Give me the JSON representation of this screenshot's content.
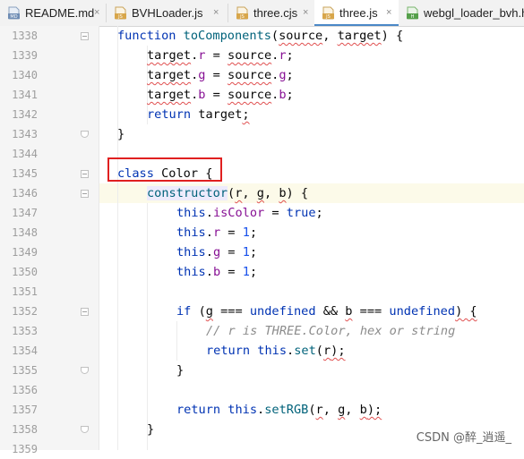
{
  "tabs": [
    {
      "label": "README.md",
      "icon": "markdown-file-icon",
      "icon_text": "MD",
      "icon_color": "#6e8cb4",
      "active": false
    },
    {
      "label": "BVHLoader.js",
      "icon": "js-file-icon",
      "icon_text": "JS",
      "icon_color": "#d8a64a",
      "active": false
    },
    {
      "label": "three.cjs",
      "icon": "js-file-icon",
      "icon_text": "JS",
      "icon_color": "#d8a64a",
      "active": false
    },
    {
      "label": "three.js",
      "icon": "js-file-icon",
      "icon_text": "JS",
      "icon_color": "#d8a64a",
      "active": true
    },
    {
      "label": "webgl_loader_bvh.ht",
      "icon": "html-file-icon",
      "icon_text": "H",
      "icon_color": "#55a04a",
      "active": false
    }
  ],
  "close_glyph": "×",
  "lines": [
    {
      "n": "1338"
    },
    {
      "n": "1339"
    },
    {
      "n": "1340"
    },
    {
      "n": "1341"
    },
    {
      "n": "1342"
    },
    {
      "n": "1343"
    },
    {
      "n": "1344"
    },
    {
      "n": "1345"
    },
    {
      "n": "1346"
    },
    {
      "n": "1347"
    },
    {
      "n": "1348"
    },
    {
      "n": "1349"
    },
    {
      "n": "1350"
    },
    {
      "n": "1351"
    },
    {
      "n": "1352"
    },
    {
      "n": "1353"
    },
    {
      "n": "1354"
    },
    {
      "n": "1355"
    },
    {
      "n": "1356"
    },
    {
      "n": "1357"
    },
    {
      "n": "1358"
    },
    {
      "n": "1359"
    }
  ],
  "code": {
    "l1338": {
      "kw": "function ",
      "fn": "toComponents",
      "p1": "(",
      "a1": "source",
      "p2": ", ",
      "a2": "target",
      "p3": ") {"
    },
    "l1339": {
      "v": "target",
      "p": ".",
      "prop": "r",
      "eq": " = ",
      "v2": "source",
      "p2": ".",
      "prop2": "r",
      "end": ";"
    },
    "l1340": {
      "v": "target",
      "p": ".",
      "prop": "g",
      "eq": " = ",
      "v2": "source",
      "p2": ".",
      "prop2": "g",
      "end": ";"
    },
    "l1341": {
      "v": "target",
      "p": ".",
      "prop": "b",
      "eq": " = ",
      "v2": "source",
      "p2": ".",
      "prop2": "b",
      "end": ";"
    },
    "l1342": {
      "kw": "return ",
      "v": "target",
      "end": ";"
    },
    "l1343": {
      "t": "}"
    },
    "l1345": {
      "kw": "class ",
      "name": "Color",
      "end": " {"
    },
    "l1346": {
      "fn": "constructor",
      "p1": "(",
      "a1": "r",
      "p2": ", ",
      "a2": "g",
      "p3": ", ",
      "a3": "b",
      "p4": ") {"
    },
    "l1347": {
      "kw": "this",
      "p": ".",
      "prop": "isColor",
      "eq": " = ",
      "kw2": "true",
      "end": ";"
    },
    "l1348": {
      "kw": "this",
      "p": ".",
      "prop": "r",
      "eq": " = ",
      "num": "1",
      "end": ";"
    },
    "l1349": {
      "kw": "this",
      "p": ".",
      "prop": "g",
      "eq": " = ",
      "num": "1",
      "end": ";"
    },
    "l1350": {
      "kw": "this",
      "p": ".",
      "prop": "b",
      "eq": " = ",
      "num": "1",
      "end": ";"
    },
    "l1352": {
      "kw": "if ",
      "p1": "(",
      "a1": "g",
      "op1": " === ",
      "kw2": "undefined",
      "op2": " && ",
      "a2": "b",
      "op3": " === ",
      "kw3": "undefined",
      "end": ") {"
    },
    "l1353": {
      "cmt": "// r is THREE.Color, hex or string"
    },
    "l1354": {
      "kw": "return ",
      "kw2": "this",
      "p": ".",
      "fn": "set",
      "p1": "(",
      "a1": "r",
      "end": ");"
    },
    "l1355": {
      "t": "}"
    },
    "l1357": {
      "kw": "return ",
      "kw2": "this",
      "p": ".",
      "fn": "setRGB",
      "p1": "(",
      "a1": "r",
      "p2": ", ",
      "a2": "g",
      "p3": ", ",
      "a3": "b",
      "end": ");"
    },
    "l1358": {
      "t": "}"
    }
  },
  "watermark": "CSDN @醉_逍遥_"
}
